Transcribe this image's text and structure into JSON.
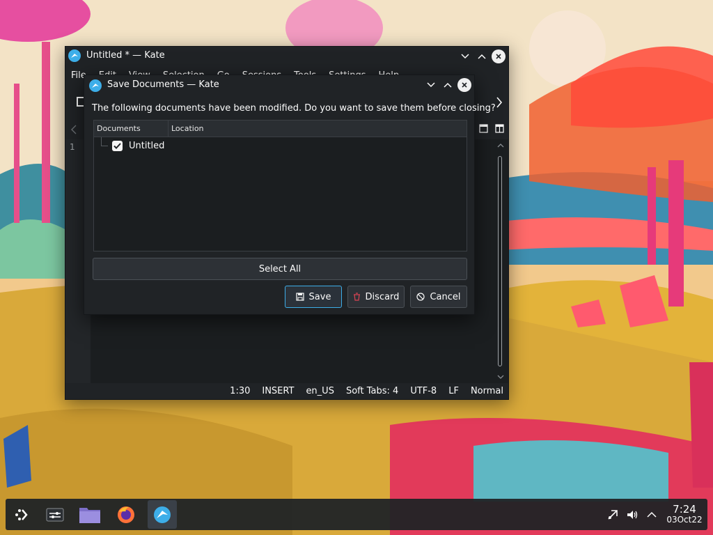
{
  "kate": {
    "title": "Untitled * — Kate",
    "menu": [
      "File",
      "Edit",
      "View",
      "Selection",
      "Go",
      "Sessions",
      "Tools",
      "Settings",
      "Help"
    ],
    "line_number": "1",
    "status": {
      "position": "1:30",
      "mode": "INSERT",
      "dictionary": "en_US",
      "indent": "Soft Tabs: 4",
      "encoding": "UTF-8",
      "eol": "LF",
      "highlighting": "Normal"
    }
  },
  "dialog": {
    "title": "Save Documents — Kate",
    "message": "The following documents have been modified. Do you want to save them before closing?",
    "columns": {
      "documents": "Documents",
      "location": "Location"
    },
    "documents": [
      {
        "name": "Untitled",
        "checked": true
      }
    ],
    "select_all_label": "Select All",
    "save_label": "Save",
    "discard_label": "Discard",
    "cancel_label": "Cancel"
  },
  "taskbar": {
    "apps": [
      "application-launcher-icon",
      "overview-icon",
      "dolphin-file-manager-icon",
      "firefox-icon",
      "kate-icon"
    ],
    "clock": {
      "time": "7:24",
      "date": "03Oct22"
    }
  },
  "colors": {
    "accent": "#3daee9",
    "window_bg": "#202326",
    "discard_red": "#da4453"
  }
}
